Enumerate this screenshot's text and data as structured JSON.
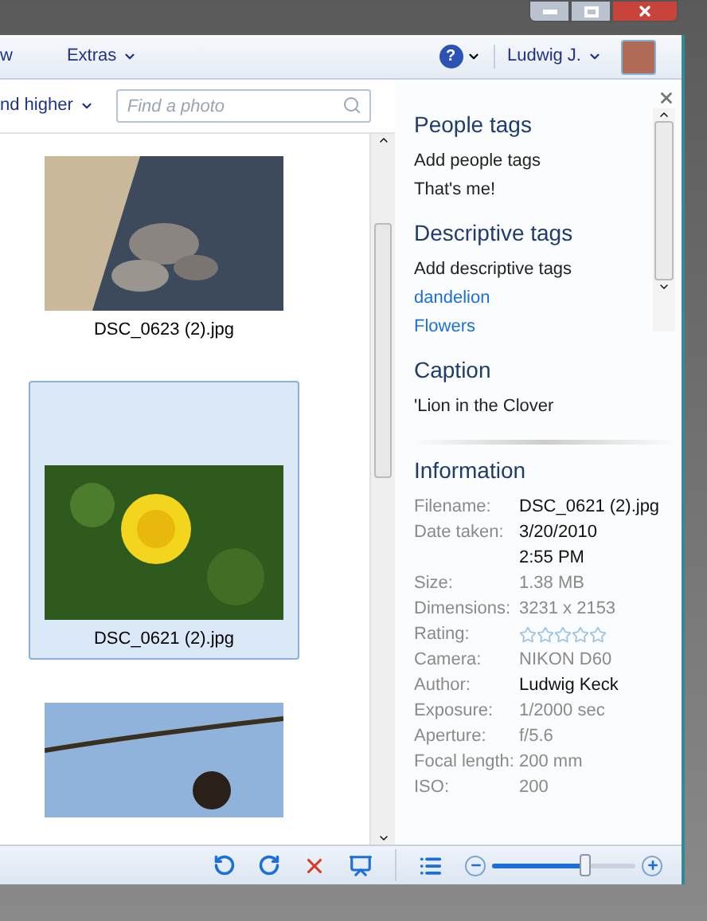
{
  "menu": [
    {
      "label": "w",
      "dropdown": false
    },
    {
      "label": "Extras",
      "dropdown": true
    }
  ],
  "help": {
    "label": "?"
  },
  "user": {
    "name": "Ludwig J."
  },
  "filter": {
    "label": "nd higher"
  },
  "search": {
    "placeholder": "Find a photo"
  },
  "photos": [
    {
      "caption": "DSC_0623 (2).jpg",
      "selected": false,
      "kind": "rocks"
    },
    {
      "caption": "DSC_0621 (2).jpg",
      "selected": true,
      "kind": "flower"
    },
    {
      "kind": "sky",
      "selected": false
    }
  ],
  "panel": {
    "sections": [
      {
        "title": "People tags",
        "items": [
          {
            "text": "Add people tags",
            "link": false
          },
          {
            "text": "That's me!",
            "link": false
          }
        ]
      },
      {
        "title": "Descriptive tags",
        "items": [
          {
            "text": "Add descriptive tags",
            "link": false
          },
          {
            "text": "dandelion",
            "link": true
          },
          {
            "text": "Flowers",
            "link": true
          }
        ]
      },
      {
        "title": "Caption",
        "items": [
          {
            "text": "'Lion in the Clover",
            "link": false
          }
        ]
      }
    ],
    "information": {
      "title": "Information",
      "rows": [
        {
          "kind": "text",
          "label": "Filename:",
          "values": [
            "DSC_0621 (2).jpg"
          ],
          "editable": true
        },
        {
          "kind": "text",
          "label": "Date taken:",
          "values": [
            "3/20/2010",
            "2:55 PM"
          ],
          "editable": true
        },
        {
          "kind": "text",
          "label": "Size:",
          "values": [
            "1.38 MB"
          ],
          "editable": false
        },
        {
          "kind": "text",
          "label": "Dimensions:",
          "values": [
            "3231 x 2153"
          ],
          "editable": false
        },
        {
          "kind": "stars",
          "label": "Rating:",
          "stars": 0
        },
        {
          "kind": "text",
          "label": "Camera:",
          "values": [
            "NIKON D60"
          ],
          "editable": false
        },
        {
          "kind": "text",
          "label": "Author:",
          "values": [
            "Ludwig Keck"
          ],
          "editable": true
        },
        {
          "kind": "text",
          "label": "Exposure:",
          "values": [
            "1/2000 sec"
          ],
          "editable": false
        },
        {
          "kind": "text",
          "label": "Aperture:",
          "values": [
            "f/5.6"
          ],
          "editable": false
        },
        {
          "kind": "text",
          "label": "Focal length:",
          "values": [
            "200 mm"
          ],
          "editable": false
        },
        {
          "kind": "text",
          "label": "ISO:",
          "values": [
            "200"
          ],
          "editable": false
        }
      ]
    }
  },
  "zoom": {
    "level": 0.65
  }
}
